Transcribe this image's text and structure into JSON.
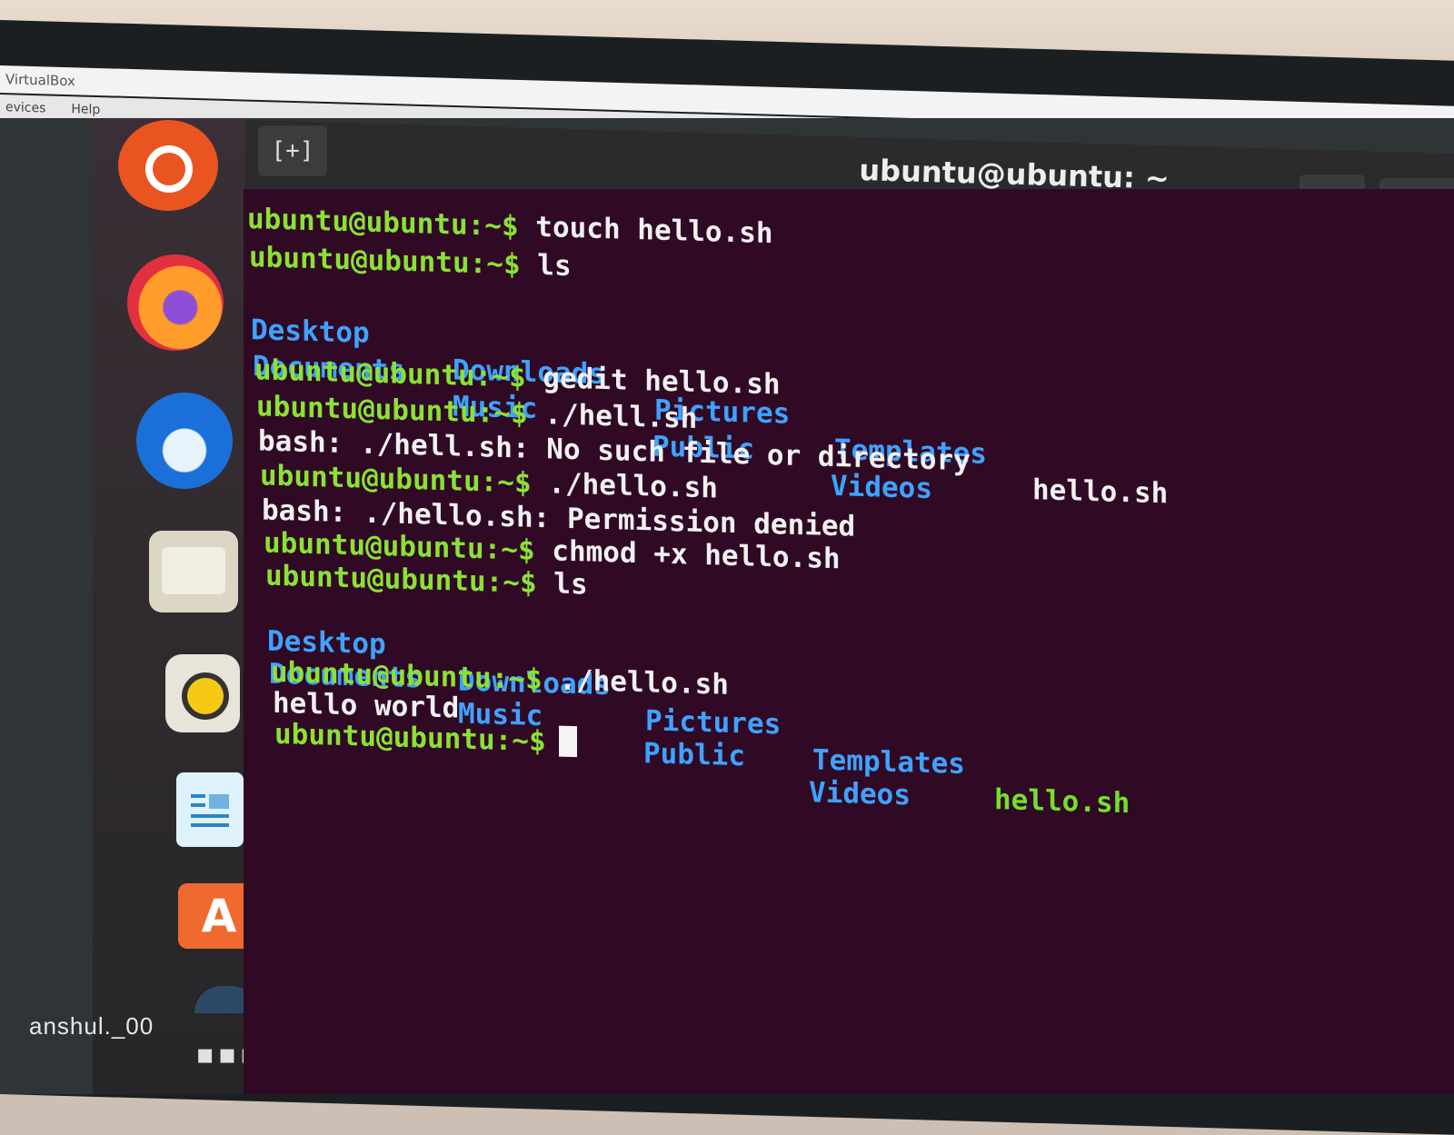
{
  "virtualbox": {
    "title": "VirtualBox",
    "menu": [
      "evices",
      "Help"
    ]
  },
  "terminal": {
    "window_title": "ubuntu@ubuntu: ~",
    "new_tab_glyph": "[+]",
    "search_glyph": "⌕",
    "menu_glyph": "≡",
    "prompt": "ubuntu@ubuntu:~$",
    "commands": {
      "touch": "touch hello.sh",
      "ls1": "ls",
      "gedit": "gedit hello.sh",
      "run_hell": "./hell.sh",
      "run_hello1": "./hello.sh",
      "chmod": "chmod +x hello.sh",
      "ls2": "ls",
      "run_hello2": "./hello.sh"
    },
    "errors": {
      "no_such_file": "bash: ./hell.sh: No such file or directory",
      "permission_denied": "bash: ./hello.sh: Permission denied"
    },
    "ls_listing": {
      "row1": [
        "Desktop",
        "Downloads",
        "Pictures",
        "Templates"
      ],
      "row2": [
        "Documents",
        "Music",
        "Public",
        "Videos"
      ],
      "file": "hello.sh"
    },
    "output": "hello world"
  },
  "dock": {
    "icons": [
      "ubuntu-logo-icon",
      "firefox-icon",
      "thunderbird-icon",
      "files-icon",
      "rhythmbox-icon",
      "libreoffice-writer-icon",
      "ubuntu-software-icon",
      "show-applications-icon"
    ],
    "apps_glyph": "▪▪▪"
  },
  "watermark": "anshul._00",
  "colors": {
    "terminal_bg": "#300a24",
    "prompt_green": "#8ae234",
    "dir_blue": "#3fa2ff",
    "exec_green": "#74e02a",
    "ubuntu_orange": "#e95420"
  }
}
